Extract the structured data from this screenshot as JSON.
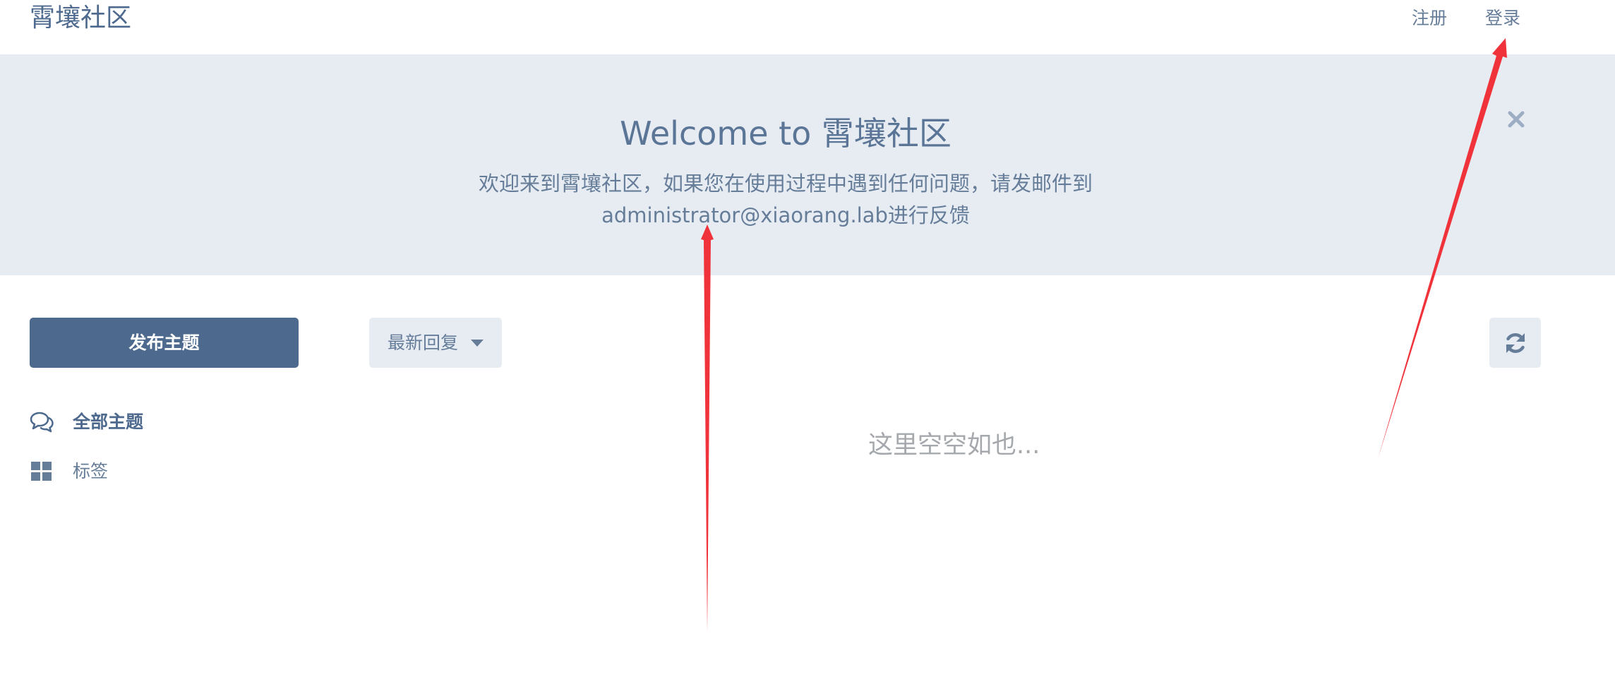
{
  "header": {
    "site_title": "霄壤社区",
    "nav": {
      "register": "注册",
      "login": "登录"
    }
  },
  "hero": {
    "title": "Welcome to 霄壤社区",
    "description": "欢迎来到霄壤社区，如果您在使用过程中遇到任何问题，请发邮件到administrator@xiaorang.lab进行反馈",
    "close_icon": "close-icon"
  },
  "toolbar": {
    "new_discussion_label": "发布主题",
    "sort_label": "最新回复",
    "refresh_icon": "refresh-icon"
  },
  "sidebar": {
    "items": [
      {
        "label": "全部主题",
        "icon": "comments-icon",
        "active": true
      },
      {
        "label": "标签",
        "icon": "grid-icon",
        "active": false
      }
    ]
  },
  "main": {
    "empty_message": "这里空空如也..."
  },
  "colors": {
    "primary": "#4d698e",
    "hero_bg": "#e7ecf3",
    "text_muted": "#667d99",
    "empty_text": "#a5a9ad",
    "annotation_arrow": "#f0333a"
  }
}
